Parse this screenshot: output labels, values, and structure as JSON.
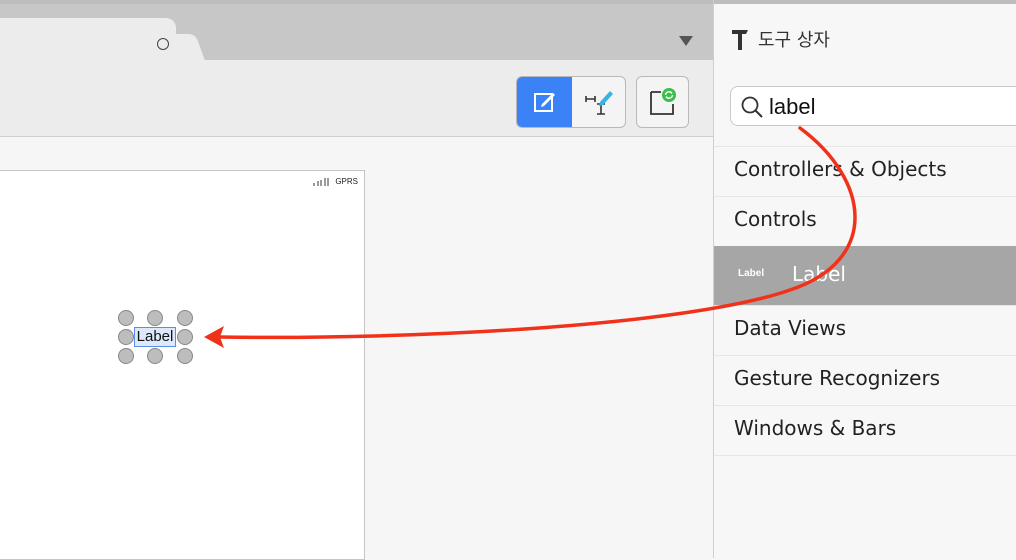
{
  "editor": {
    "tab_close_icon": "circle-icon",
    "tab_dropdown_icon": "chevron-down-icon",
    "toolbar": {
      "edit_icon": "edit-icon",
      "size_inspector_icon": "ruler-pen-icon",
      "refresh_icon": "refresh-view-icon"
    },
    "device": {
      "carrier": "GPRS"
    },
    "selected_label": {
      "text": "Label"
    }
  },
  "toolbox": {
    "icon": "hammer-icon",
    "title": "도구 상자",
    "search": {
      "value": "label"
    },
    "categories": [
      {
        "label": "Controllers & Objects"
      },
      {
        "label": "Controls"
      },
      {
        "label": "Label",
        "thumb": "Label",
        "selected": true
      },
      {
        "label": "Data Views"
      },
      {
        "label": "Gesture Recognizers"
      },
      {
        "label": "Windows & Bars"
      }
    ]
  },
  "colors": {
    "accent": "#3b82f6",
    "annotation_arrow": "#f0321a",
    "selected_row": "#a6a6a6"
  }
}
